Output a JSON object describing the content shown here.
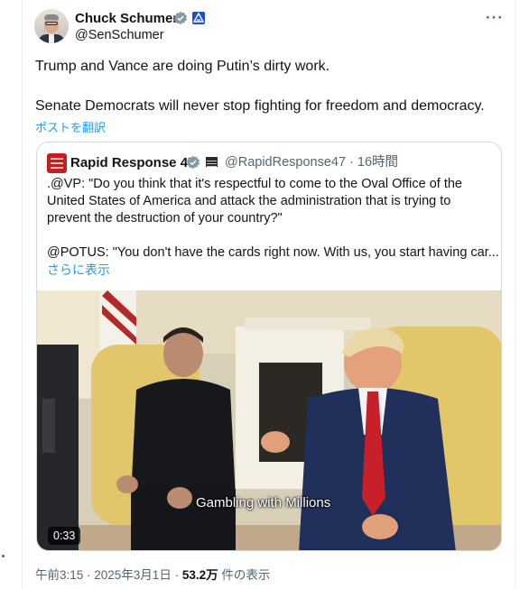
{
  "author": {
    "name": "Chuck Schumer",
    "handle": "@SenSchumer"
  },
  "tweet": {
    "lines": [
      "Trump and Vance are doing Putin’s dirty work.",
      "Senate Democrats will never stop fighting for freedom and democracy."
    ],
    "translate_label": "ポストを翻訳"
  },
  "quoted": {
    "name": "Rapid Response 47",
    "handle_time": "@RapidResponse47 · 16時間",
    "lines": [
      ".@VP: \"Do you think that it's respectful to come to the Oval Office of the",
      "United States of America and attack the administration that is trying to",
      "prevent the destruction of your country?\"",
      "@POTUS: \"You don't have the cards right now. With us, you start having car..."
    ],
    "show_more": "さらに表示",
    "video": {
      "duration": "0:33",
      "caption": "Gambling with Millions"
    }
  },
  "footer": {
    "time": "午前3:15 · 2025年3月1日 · ",
    "views_count": "53.2万",
    "views_label": " 件の表示"
  },
  "colors": {
    "link": "#1d9bf0",
    "verified": "#829aab",
    "border": "#cfd9de",
    "secondary_text": "#536471"
  },
  "icons": {
    "verified": "verified-badge-icon",
    "government": "government-label-icon",
    "more": "more-options-icon"
  }
}
